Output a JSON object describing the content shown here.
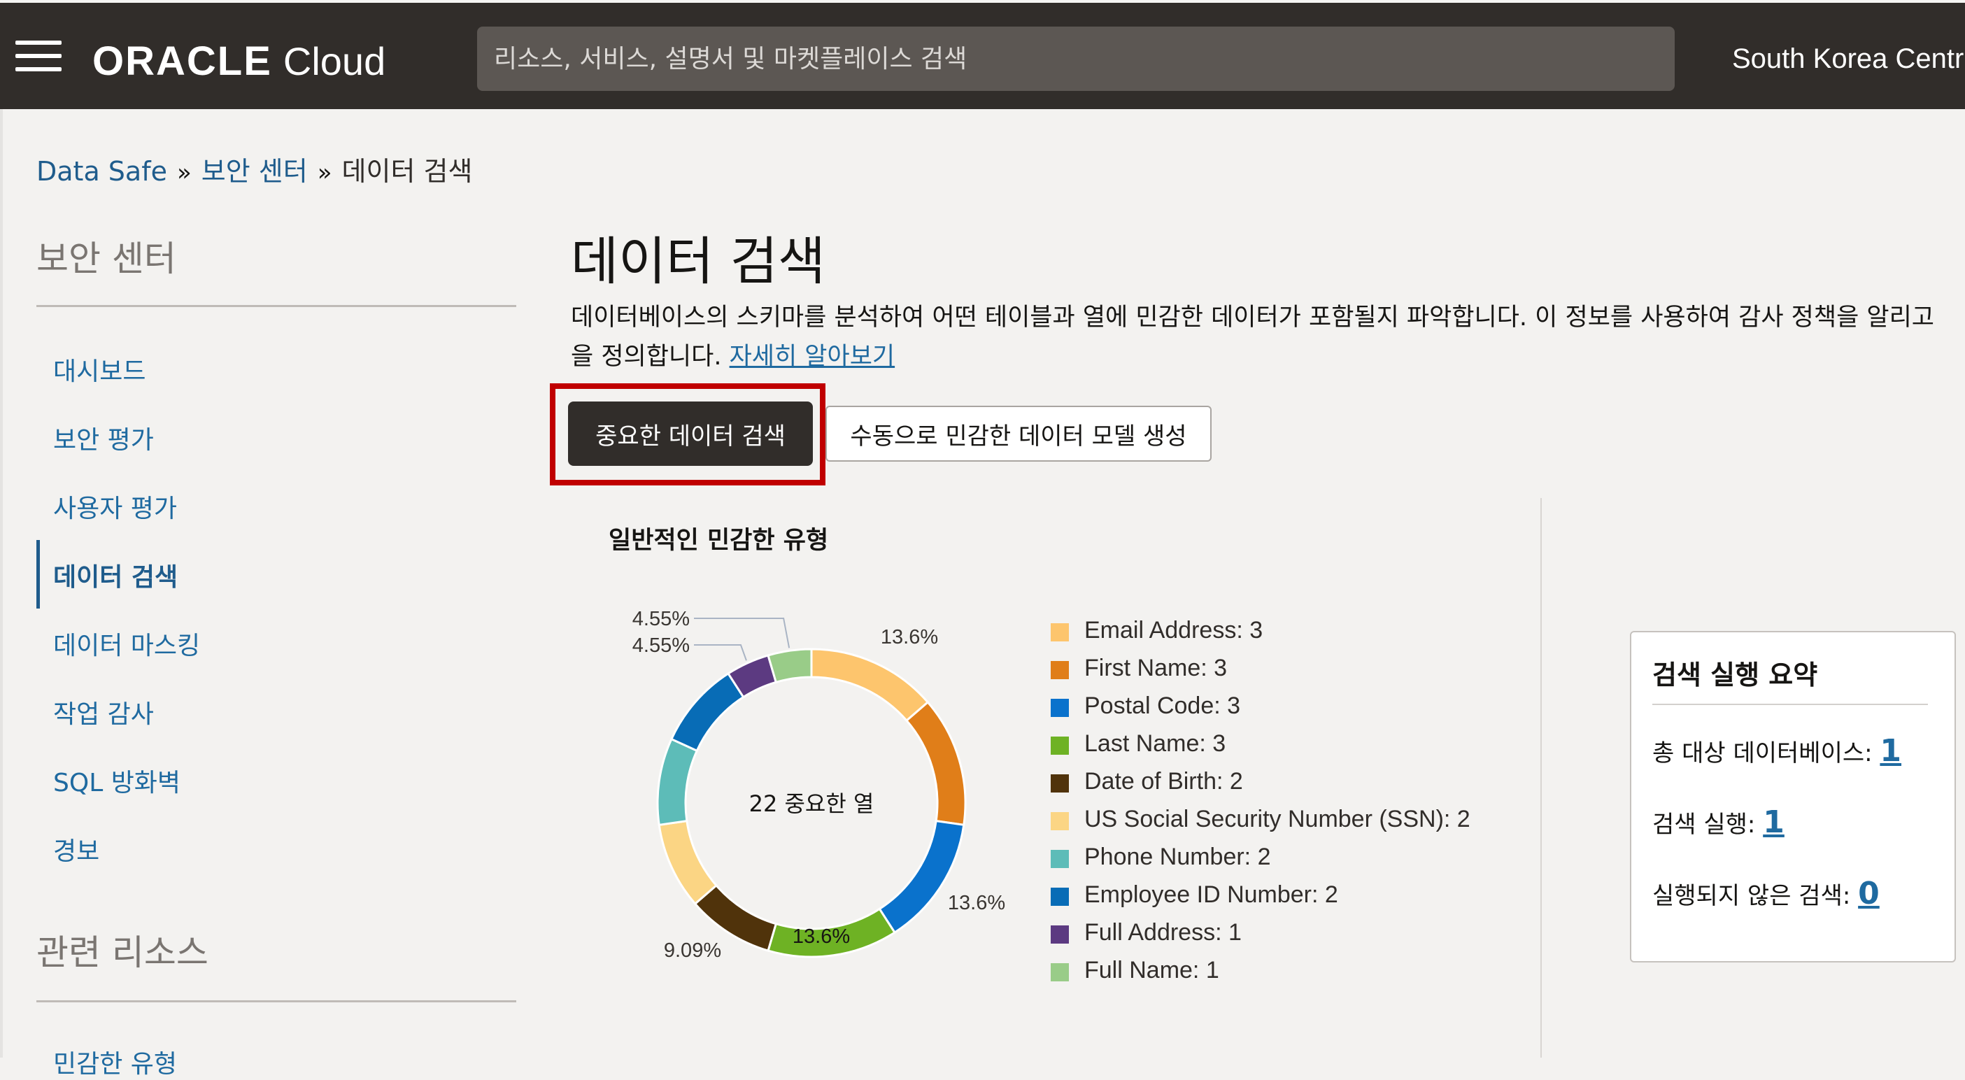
{
  "header": {
    "logo_oracle": "ORACLE",
    "logo_cloud": "Cloud",
    "search_placeholder": "리소스, 서비스, 설명서 및 마켓플레이스 검색",
    "region": "South Korea Centr"
  },
  "breadcrumb": {
    "items": [
      "Data Safe",
      "보안 센터"
    ],
    "current": "데이터 검색",
    "separator": "»"
  },
  "sidebar": {
    "title": "보안 센터",
    "items": [
      {
        "label": "대시보드"
      },
      {
        "label": "보안 평가"
      },
      {
        "label": "사용자 평가"
      },
      {
        "label": "데이터 검색",
        "active": true
      },
      {
        "label": "데이터 마스킹"
      },
      {
        "label": "작업 감사"
      },
      {
        "label": "SQL 방화벽"
      },
      {
        "label": "경보"
      }
    ],
    "related_title": "관련 리소스",
    "related_first": "민감한 유형"
  },
  "main": {
    "title": "데이터 검색",
    "desc_line1": "데이터베이스의 스키마를 분석하여 어떤 테이블과 열에 민감한 데이터가 포함될지 파악합니다. 이 정보를 사용하여 감사 정책을 알리고",
    "desc_line2": "을 정의합니다. ",
    "learn_more": "자세히 알아보기",
    "primary_button": "중요한 데이터 검색",
    "secondary_button": "수동으로 민감한 데이터 모델 생성",
    "highlight_color": "#c00000"
  },
  "chart_data": {
    "type": "pie",
    "title": "일반적인 민감한 유형",
    "center_label": "22 중요한 열",
    "total": 22,
    "series": [
      {
        "name": "Email Address",
        "value": 3,
        "color": "#fdc56d"
      },
      {
        "name": "First Name",
        "value": 3,
        "color": "#e07e19"
      },
      {
        "name": "Postal Code",
        "value": 3,
        "color": "#0a72cc"
      },
      {
        "name": "Last Name",
        "value": 3,
        "color": "#6eb224"
      },
      {
        "name": "Date of Birth",
        "value": 2,
        "color": "#50330b"
      },
      {
        "name": "US Social Security Number (SSN)",
        "value": 2,
        "color": "#fbd584"
      },
      {
        "name": "Phone Number",
        "value": 2,
        "color": "#5dbcb8"
      },
      {
        "name": "Employee ID Number",
        "value": 2,
        "color": "#086cb6"
      },
      {
        "name": "Full Address",
        "value": 1,
        "color": "#5c3a81"
      },
      {
        "name": "Full Name",
        "value": 1,
        "color": "#99cc88"
      }
    ],
    "data_labels": [
      {
        "text": "13.6%",
        "slice": 0
      },
      {
        "text": "13.6%",
        "slice": 2
      },
      {
        "text": "13.6%",
        "slice": 3
      },
      {
        "text": "9.09%",
        "slice": 4
      },
      {
        "text": "4.55%",
        "slice": 8
      },
      {
        "text": "4.55%",
        "slice": 9
      }
    ]
  },
  "summary": {
    "title": "검색 실행 요약",
    "rows": [
      {
        "label": "총 대상 데이터베이스: ",
        "value": "1"
      },
      {
        "label": "검색 실행: ",
        "value": "1"
      },
      {
        "label": "실행되지 않은 검색: ",
        "value": "0"
      }
    ]
  }
}
